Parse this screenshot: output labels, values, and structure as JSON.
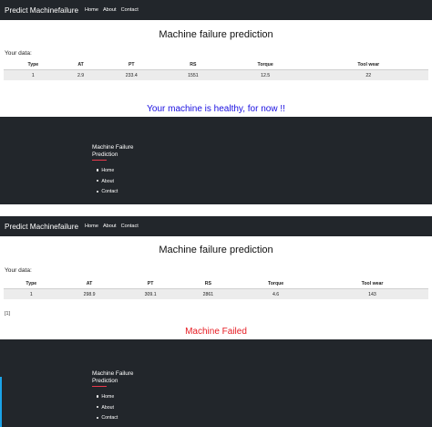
{
  "screens": [
    {
      "nav": {
        "brand": "Predict Machinefailure",
        "links": [
          "Home",
          "About",
          "Contact"
        ]
      },
      "title": "Machine failure prediction",
      "data_label": "Your data:",
      "table": {
        "columns": [
          "Type",
          "AT",
          "PT",
          "RS",
          "Torque",
          "Tool wear"
        ],
        "row": [
          "1",
          "2.9",
          "233.4",
          "1551",
          "12.5",
          "22"
        ]
      },
      "prediction_raw": "",
      "result": {
        "text": "Your machine is healthy, for now !!",
        "color": "#1a0fe0"
      },
      "footer": {
        "title": "Machine Failure Prediction",
        "links": [
          "Home",
          "About",
          "Contact"
        ]
      }
    },
    {
      "nav": {
        "brand": "Predict Machinefailure",
        "links": [
          "Home",
          "About",
          "Contact"
        ]
      },
      "title": "Machine failure prediction",
      "data_label": "Your data:",
      "table": {
        "columns": [
          "Type",
          "AT",
          "PT",
          "RS",
          "Torque",
          "Tool wear"
        ],
        "row": [
          "1",
          "298.9",
          "309.1",
          "2861",
          "4.6",
          "143"
        ]
      },
      "prediction_raw": "[1]",
      "result": {
        "text": "Machine Failed",
        "color": "#e61b22"
      },
      "footer": {
        "title": "Machine Failure Prediction",
        "links": [
          "Home",
          "About",
          "Contact"
        ]
      }
    }
  ]
}
